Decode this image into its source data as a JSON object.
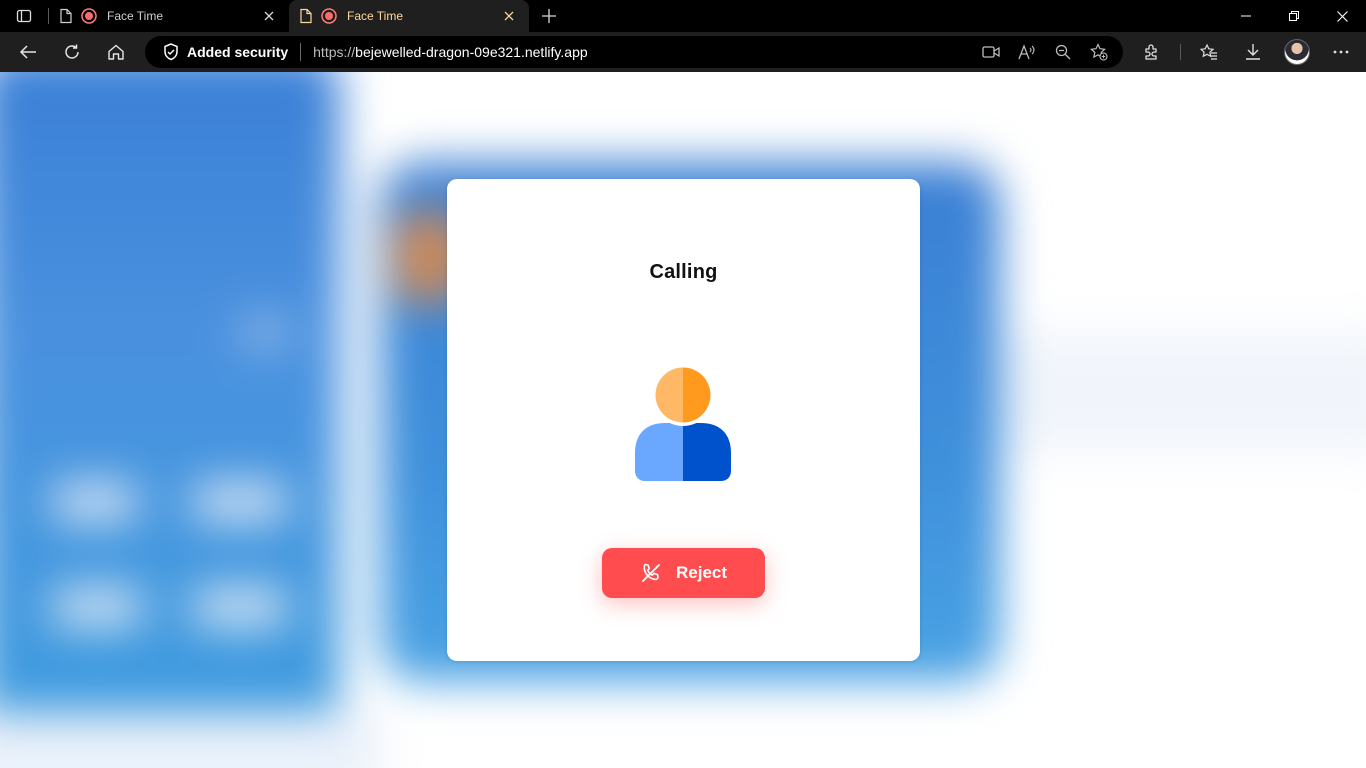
{
  "browser": {
    "tabs": [
      {
        "title": "Face Time",
        "active": false
      },
      {
        "title": "Face Time",
        "active": true
      }
    ],
    "address": {
      "security_label": "Added security",
      "url_scheme": "https://",
      "url_host": "bejewelled-dragon-09e321.netlify.app"
    },
    "icons": {
      "tab_actions": "tab-actions-icon",
      "page": "page-icon",
      "recording": "recording-icon",
      "close": "close-icon",
      "new_tab": "plus-icon",
      "back": "back-arrow-icon",
      "refresh": "refresh-icon",
      "home": "home-icon",
      "shield": "shield-icon",
      "camera": "video-camera-icon",
      "read_aloud": "read-aloud-icon",
      "zoom": "zoom-out-icon",
      "favorite_add": "add-favorite-icon",
      "extensions": "extensions-icon",
      "favorites": "favorites-icon",
      "downloads": "download-icon",
      "profile": "profile-avatar",
      "more": "more-icon"
    }
  },
  "call": {
    "title": "Calling",
    "reject_label": "Reject",
    "colors": {
      "reject": "#ff4d4f",
      "avatar_head_light": "#ffb865",
      "avatar_head_dark": "#ff9a1f",
      "avatar_body_light": "#6aa8ff",
      "avatar_body_dark": "#0052cc"
    }
  }
}
